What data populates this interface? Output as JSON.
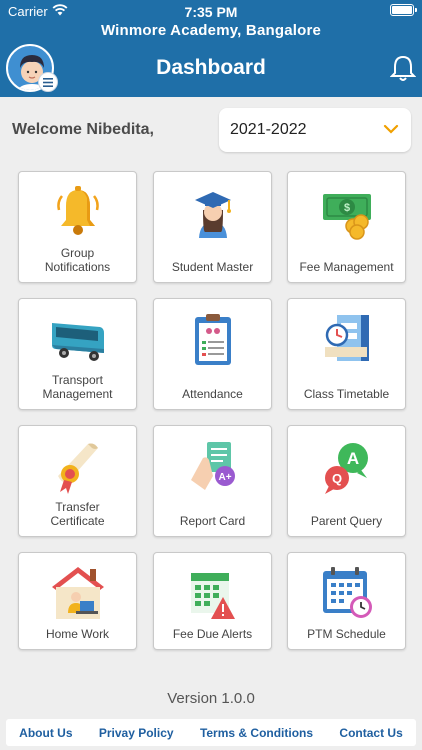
{
  "status": {
    "carrier": "Carrier",
    "time": "7:35 PM"
  },
  "header": {
    "school": "Winmore Academy, Bangalore",
    "title": "Dashboard"
  },
  "welcome": "Welcome Nibedita,",
  "year_select": {
    "value": "2021-2022"
  },
  "tiles": [
    {
      "label": "Group\nNotifications",
      "icon": "bell-icon"
    },
    {
      "label": "Student Master",
      "icon": "graduate-icon"
    },
    {
      "label": "Fee Management",
      "icon": "money-icon"
    },
    {
      "label": "Transport\nManagement",
      "icon": "bus-icon"
    },
    {
      "label": "Attendance",
      "icon": "clipboard-icon"
    },
    {
      "label": "Class Timetable",
      "icon": "timetable-icon"
    },
    {
      "label": "Transfer\nCertificate",
      "icon": "certificate-icon"
    },
    {
      "label": "Report Card",
      "icon": "report-card-icon"
    },
    {
      "label": "Parent Query",
      "icon": "qa-icon"
    },
    {
      "label": "Home Work",
      "icon": "home-work-icon"
    },
    {
      "label": "Fee Due Alerts",
      "icon": "fee-alert-icon"
    },
    {
      "label": "PTM Schedule",
      "icon": "calendar-icon"
    }
  ],
  "version": "Version 1.0.0",
  "footer": {
    "about": "About Us",
    "privacy": "Privay Policy",
    "terms": "Terms & Conditions",
    "contact": "Contact Us"
  },
  "colors": {
    "header": "#1f6fa8",
    "link": "#1f5fa0",
    "accent": "#f0a000"
  }
}
